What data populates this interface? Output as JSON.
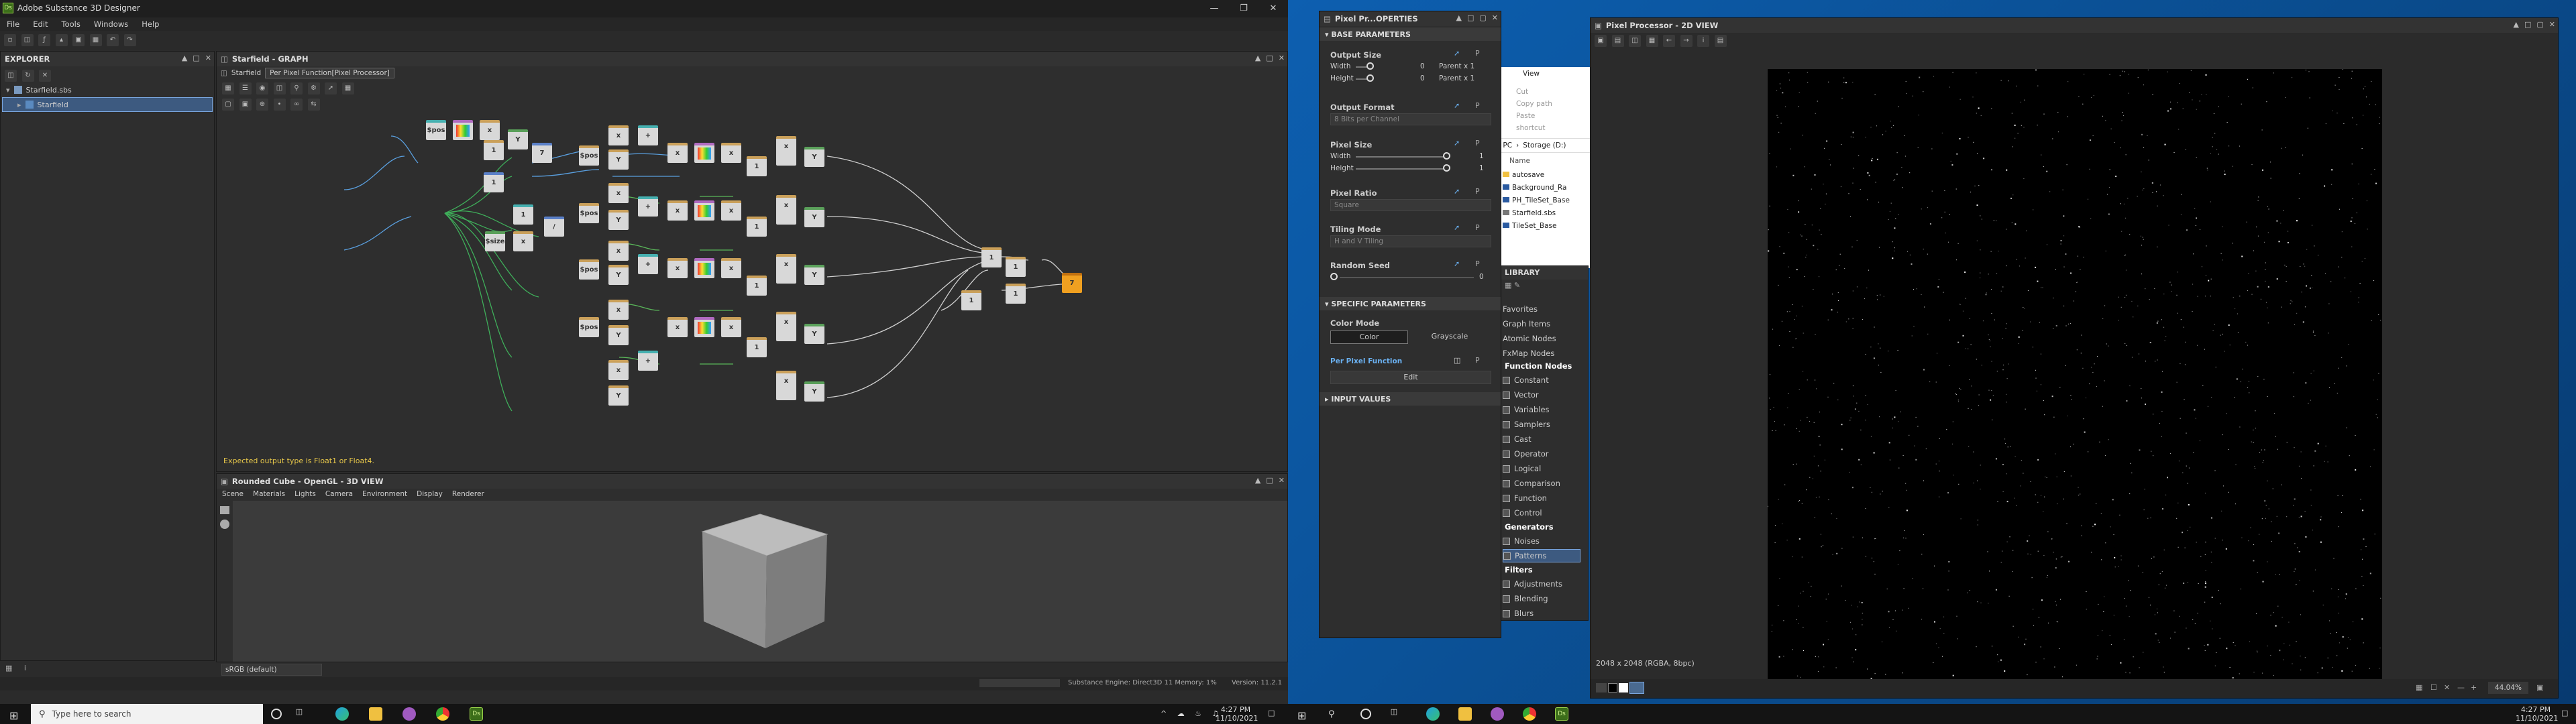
{
  "app": {
    "title": "Adobe Substance 3D Designer",
    "logo": "Ds",
    "menu": [
      "File",
      "Edit",
      "Tools",
      "Windows",
      "Help"
    ]
  },
  "explorer": {
    "title": "EXPLORER",
    "package": "Starfield.sbs",
    "graph": "Starfield"
  },
  "graph": {
    "title": "Starfield - GRAPH",
    "breadcrumbs": [
      "Starfield",
      "Per Pixel Function[Pixel Processor]"
    ],
    "error_text": "Expected output type is Float1 or Float4.",
    "node_labels": {
      "pos": "$pos",
      "size": "$size",
      "mul": "x",
      "div": "/",
      "add": "+",
      "swz": "Y",
      "one": "1",
      "seven": "7",
      "rand": "rnd",
      "out": "7"
    }
  },
  "view3d": {
    "title": "Rounded Cube - OpenGL - 3D VIEW",
    "menu": [
      "Scene",
      "Materials",
      "Lights",
      "Camera",
      "Environment",
      "Display",
      "Renderer"
    ],
    "colorspace": "sRGB (default)"
  },
  "statusbar": {
    "engine": "Substance Engine: Direct3D 11  Memory: 1%",
    "version": "Version: 11.2.1"
  },
  "properties": {
    "title": "Pixel Pr...OPERTIES",
    "base_header": "BASE PARAMETERS",
    "output_size": {
      "label": "Output Size",
      "width_label": "Width",
      "height_label": "Height",
      "width_value": "0",
      "height_value": "0",
      "width_mode": "Parent x 1",
      "height_mode": "Parent x 1"
    },
    "output_format": {
      "label": "Output Format",
      "value": "8 Bits per Channel"
    },
    "pixel_size": {
      "label": "Pixel Size",
      "width_label": "Width",
      "height_label": "Height",
      "width_value": "1",
      "height_value": "1",
      "width_fraction": 1.0,
      "height_fraction": 1.0
    },
    "pixel_ratio": {
      "label": "Pixel Ratio",
      "value": "Square"
    },
    "tiling_mode": {
      "label": "Tiling Mode",
      "value": "H and V Tiling"
    },
    "random_seed": {
      "label": "Random Seed",
      "value": "0"
    },
    "specific_header": "SPECIFIC PARAMETERS",
    "color_mode": {
      "label": "Color Mode",
      "color": "Color",
      "grayscale": "Grayscale"
    },
    "per_pixel_function": "Per Pixel Function",
    "edit": "Edit",
    "input_values": "INPUT VALUES"
  },
  "file_explorer": {
    "view_tab": "View",
    "cut": "Cut",
    "copy_path": "Copy path",
    "paste_shortcut": "Paste shortcut",
    "path": [
      "his PC",
      "Storage (D:)"
    ],
    "name_header": "Name",
    "files": [
      "autosave",
      "Background_Ra",
      "PH_TileSet_Base",
      "Starfield.sbs",
      "TileSet_Base"
    ]
  },
  "library": {
    "title": "LIBRARY",
    "items_top": [
      "Favorites",
      "Graph Items",
      "Atomic Nodes",
      "FxMap Nodes"
    ],
    "function_header": "Function Nodes",
    "function_items": [
      "Constant",
      "Vector",
      "Variables",
      "Samplers",
      "Cast",
      "Operator",
      "Logical",
      "Comparison",
      "Function",
      "Control"
    ],
    "generators_header": "Generators",
    "generator_items": [
      "Noises",
      "Patterns"
    ],
    "filters_header": "Filters",
    "filter_items": [
      "Adjustments",
      "Blending",
      "Blurs"
    ]
  },
  "view2d": {
    "title": "Pixel Processor - 2D VIEW",
    "resolution": "2048 x 2048 (RGBA, 8bpc)",
    "zoom": "44.04%"
  },
  "taskbar_left": {
    "search_placeholder": "Type here to search",
    "time": "4:27 PM",
    "date": "11/10/2021"
  },
  "taskbar_right": {
    "time": "4:27 PM",
    "date": "11/10/2021"
  },
  "colors": {
    "accent": "#f0a020",
    "selection": "#3d5a80",
    "desktop": "#0a4a8a",
    "panel": "#2e2e2e"
  }
}
